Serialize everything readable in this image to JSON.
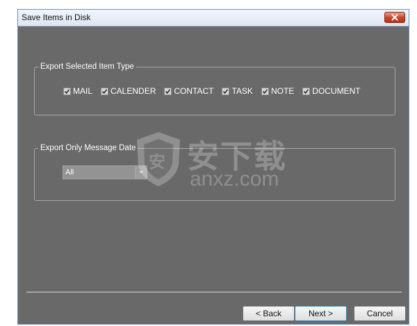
{
  "window": {
    "title": "Save Items in Disk",
    "close_symbol": "✕"
  },
  "item_type_group": {
    "legend": "Export Selected Item Type",
    "items": [
      {
        "label": "MAIL",
        "checked": true
      },
      {
        "label": "CALENDER",
        "checked": true
      },
      {
        "label": "CONTACT",
        "checked": true
      },
      {
        "label": "TASK",
        "checked": true
      },
      {
        "label": "NOTE",
        "checked": true
      },
      {
        "label": "DOCUMENT",
        "checked": true
      }
    ]
  },
  "date_group": {
    "legend": "Export Only Message Date",
    "combo_value": "All"
  },
  "buttons": {
    "back": "< Back",
    "next": "Next >",
    "cancel": "Cancel"
  },
  "watermark": {
    "text_cn": "安下载",
    "text_url": "anxz.com",
    "badge_char": "安"
  },
  "colors": {
    "dialog_bg": "#696969",
    "close_red": "#c7432a"
  },
  "icons": [
    "close-icon",
    "checkbox-checked-icon",
    "dropdown-arrow-icon",
    "shield-icon"
  ]
}
